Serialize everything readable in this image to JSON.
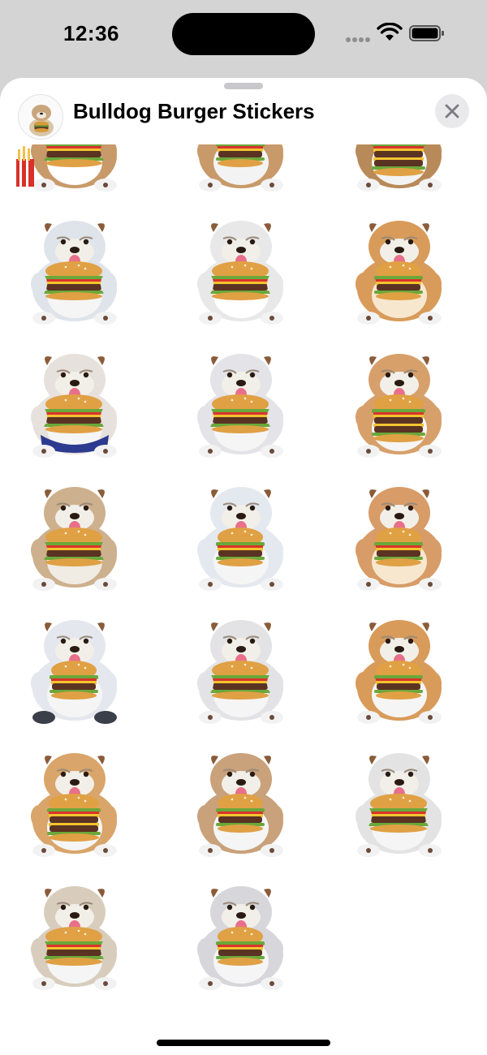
{
  "status_bar": {
    "time": "12:36"
  },
  "sheet": {
    "title": "Bulldog Burger Stickers",
    "close_icon": "close-icon"
  },
  "colors": {
    "sheet_background": "#ffffff",
    "close_button_background": "#e9e9eb"
  },
  "stickers": [
    {
      "fur": "#c89a6a",
      "belly": "#ffffff",
      "burger": "large",
      "extra": "fries"
    },
    {
      "fur": "#c89a6a",
      "belly": "#f3f3f3",
      "burger": "medium",
      "extra": ""
    },
    {
      "fur": "#b88a5a",
      "belly": "#f3f3f3",
      "burger": "double",
      "extra": ""
    },
    {
      "fur": "#dfe4ea",
      "belly": "#f5f5f5",
      "burger": "large",
      "extra": ""
    },
    {
      "fur": "#e8e8e8",
      "belly": "#ffffff",
      "burger": "large",
      "extra": ""
    },
    {
      "fur": "#d89b5a",
      "belly": "#f7e7cf",
      "burger": "medium",
      "extra": ""
    },
    {
      "fur": "#e6e1dc",
      "belly": "#f5f5f5",
      "burger": "large",
      "extra": "shorts"
    },
    {
      "fur": "#e3e3e8",
      "belly": "#f5f5f5",
      "burger": "large",
      "extra": ""
    },
    {
      "fur": "#d7a06b",
      "belly": "#f5f5f5",
      "burger": "double",
      "extra": ""
    },
    {
      "fur": "#cdb08d",
      "belly": "#f0ebe3",
      "burger": "large",
      "extra": ""
    },
    {
      "fur": "#e4e8ef",
      "belly": "#f5f5f5",
      "burger": "medium",
      "extra": ""
    },
    {
      "fur": "#d79c68",
      "belly": "#f7e7cf",
      "burger": "medium",
      "extra": ""
    },
    {
      "fur": "#e5e7ee",
      "belly": "#f5f5f5",
      "burger": "medium",
      "extra": "shoes"
    },
    {
      "fur": "#e3e3e6",
      "belly": "#f5f5f5",
      "burger": "large",
      "extra": ""
    },
    {
      "fur": "#d89b5a",
      "belly": "#f5f5f5",
      "burger": "medium",
      "extra": ""
    },
    {
      "fur": "#d9a56a",
      "belly": "#f5f5f5",
      "burger": "double",
      "extra": ""
    },
    {
      "fur": "#c9a17a",
      "belly": "#f5f5f5",
      "burger": "medium",
      "extra": ""
    },
    {
      "fur": "#e3e3e3",
      "belly": "#f5f5f5",
      "burger": "large",
      "extra": ""
    },
    {
      "fur": "#d8cdbd",
      "belly": "#f5f5f5",
      "burger": "large",
      "extra": ""
    },
    {
      "fur": "#d6d6db",
      "belly": "#f5f5f5",
      "burger": "medium",
      "extra": ""
    }
  ]
}
